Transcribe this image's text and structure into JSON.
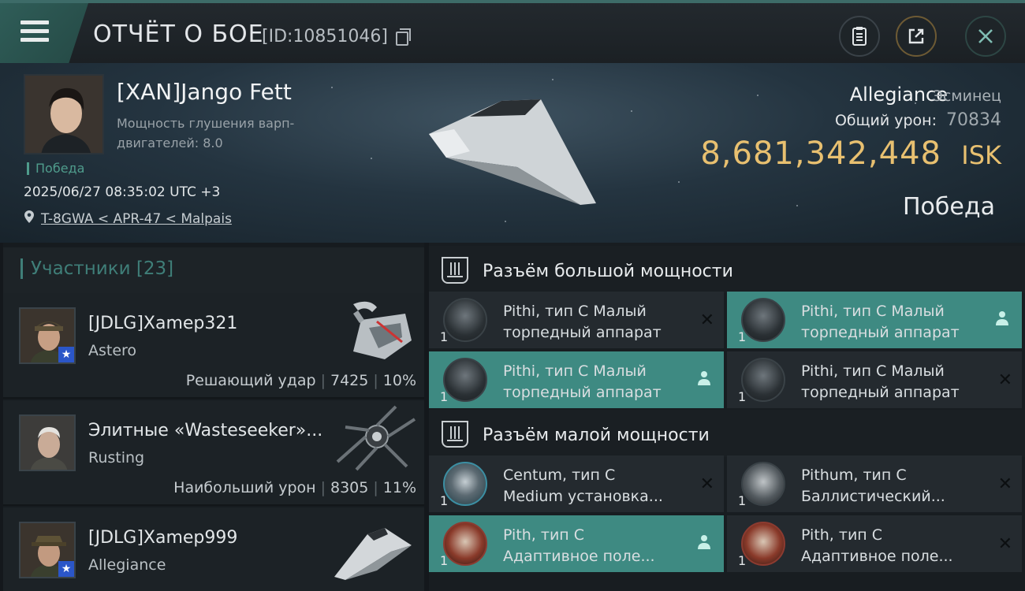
{
  "topbar": {
    "title": "ОТЧЁТ О БОЕ",
    "battle_id": "[ID:10851046]",
    "icons": [
      "menu-icon",
      "copy-icon",
      "clipboard-icon",
      "share-icon",
      "close-icon"
    ]
  },
  "victim": {
    "name": "[XAN]Jango Fett",
    "jam_label": "Мощность глушения варп-двигателей: 8.0",
    "result_small": "Победа",
    "datetime": "2025/06/27 08:35:02 UTC +3",
    "location": "T-8GWA < APR-47 < Malpais",
    "ship_name": "Allegiance",
    "ship_class": "Эсминец",
    "total_damage_label": "Общий урон:",
    "total_damage": "70834",
    "isk_value": "8,681,342,448",
    "isk_unit": "ISK",
    "result_big": "Победа"
  },
  "participants": {
    "header": "Участники [23]",
    "rows": [
      {
        "name": "[JDLG]Xamep321",
        "ship": "Astero",
        "label": "Решающий удар",
        "damage": "7425",
        "percent": "10%"
      },
      {
        "name": "Элитные «Wasteseeker»...",
        "ship": "Rusting",
        "label": "Наибольший урон",
        "damage": "8305",
        "percent": "11%"
      },
      {
        "name": "[JDLG]Xamep999",
        "ship": "Allegiance",
        "label": "",
        "damage": "",
        "percent": ""
      }
    ]
  },
  "slots": {
    "high_title": "Разъём большой мощности",
    "low_title": "Разъём малой мощности",
    "high": [
      {
        "line1": "Pithi, тип C Малый",
        "line2": "торпедный аппарат",
        "qty": "1",
        "status": "destroyed"
      },
      {
        "line1": "Pithi, тип C Малый",
        "line2": "торпедный аппарат",
        "qty": "1",
        "status": "dropped"
      },
      {
        "line1": "Pithi, тип C Малый",
        "line2": "торпедный аппарат",
        "qty": "1",
        "status": "dropped"
      },
      {
        "line1": "Pithi, тип C Малый",
        "line2": "торпедный аппарат",
        "qty": "1",
        "status": "destroyed"
      }
    ],
    "low": [
      {
        "line1": "Centum, тип C",
        "line2": "Medium установка...",
        "qty": "1",
        "status": "destroyed"
      },
      {
        "line1": "Pithum, тип C",
        "line2": "Баллистический...",
        "qty": "1",
        "status": "destroyed"
      },
      {
        "line1": "Pith, тип C",
        "line2": "Адаптивное поле...",
        "qty": "1",
        "status": "dropped"
      },
      {
        "line1": "Pith, тип C",
        "line2": "Адаптивное поле...",
        "qty": "1",
        "status": "destroyed"
      }
    ],
    "status_marks": {
      "destroyed": "✕"
    }
  },
  "colors": {
    "accent": "#3e8a82",
    "isk": "#e8c070",
    "background": "#14181c"
  }
}
